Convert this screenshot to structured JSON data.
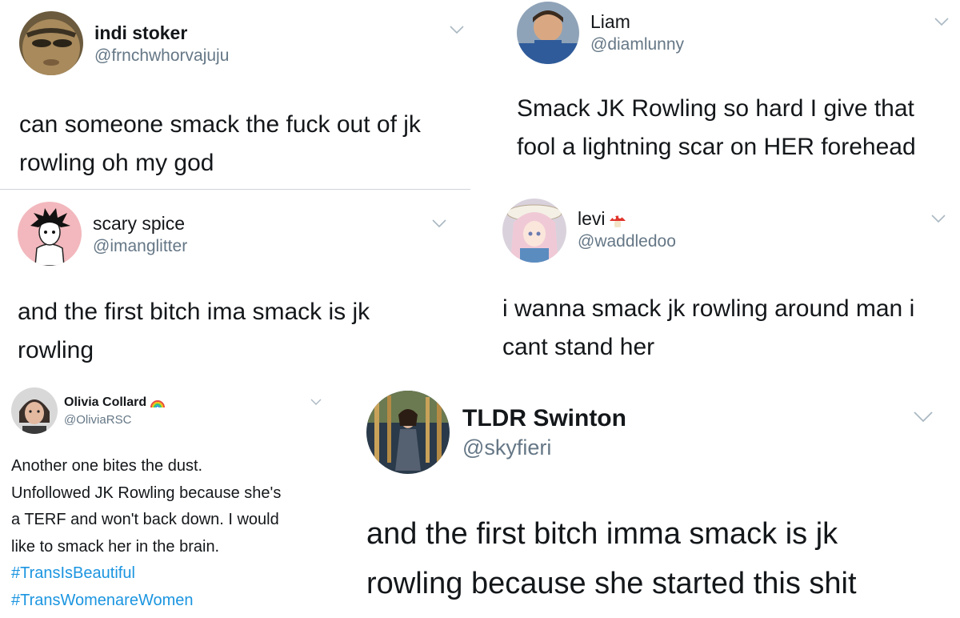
{
  "tweets": [
    {
      "name": "indi stoker",
      "handle": "@frnchwhorvajuju",
      "lines": [
        "can someone smack the fuck out of jk",
        "rowling oh my god"
      ]
    },
    {
      "name": "Liam",
      "handle": "@diamlunny",
      "lines": [
        "Smack JK Rowling so hard I give that",
        "fool a lightning scar on HER forehead"
      ]
    },
    {
      "name": "scary spice",
      "handle": "@imanglitter",
      "lines": [
        "and the first bitch ima smack is jk",
        "rowling"
      ]
    },
    {
      "name": "levi",
      "name_emoji": "mushroom-emoji",
      "handle": "@waddledoo",
      "lines": [
        "i wanna smack jk rowling around man i",
        "cant stand her"
      ]
    },
    {
      "name": "Olivia Collard",
      "name_emoji": "rainbow-emoji",
      "handle": "@OliviaRSC",
      "lines": [
        "Another one bites the dust.",
        "Unfollowed JK Rowling because she's",
        "a TERF and won't back down. I would",
        "like to smack her in the brain."
      ],
      "hashtags": [
        "#TransIsBeautiful",
        "#TransWomenareWomen"
      ]
    },
    {
      "name": "TLDR Swinton",
      "handle": "@skyfieri",
      "lines": [
        "and the first bitch imma smack is jk",
        "rowling because she started this shit"
      ]
    }
  ],
  "colors": {
    "name": "#14171a",
    "handle": "#657786",
    "hashtag": "#1b95e0",
    "chevron": "#aab8c2",
    "divider": "#cfd4d9"
  },
  "icons": {
    "menu": "chevron-down-icon"
  }
}
